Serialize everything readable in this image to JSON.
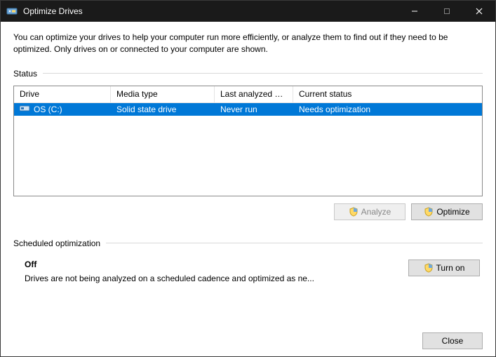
{
  "window": {
    "title": "Optimize Drives"
  },
  "intro": "You can optimize your drives to help your computer run more efficiently, or analyze them to find out if they need to be optimized. Only drives on or connected to your computer are shown.",
  "status_section_label": "Status",
  "table": {
    "headers": {
      "drive": "Drive",
      "media": "Media type",
      "last": "Last analyzed or o...",
      "status": "Current status"
    },
    "rows": [
      {
        "drive": "OS (C:)",
        "media": "Solid state drive",
        "last": "Never run",
        "status": "Needs optimization",
        "selected": true
      }
    ]
  },
  "buttons": {
    "analyze": "Analyze",
    "optimize": "Optimize",
    "turn_on": "Turn on",
    "close": "Close"
  },
  "sched": {
    "section_label": "Scheduled optimization",
    "state": "Off",
    "desc": "Drives are not being analyzed on a scheduled cadence and optimized as ne..."
  }
}
